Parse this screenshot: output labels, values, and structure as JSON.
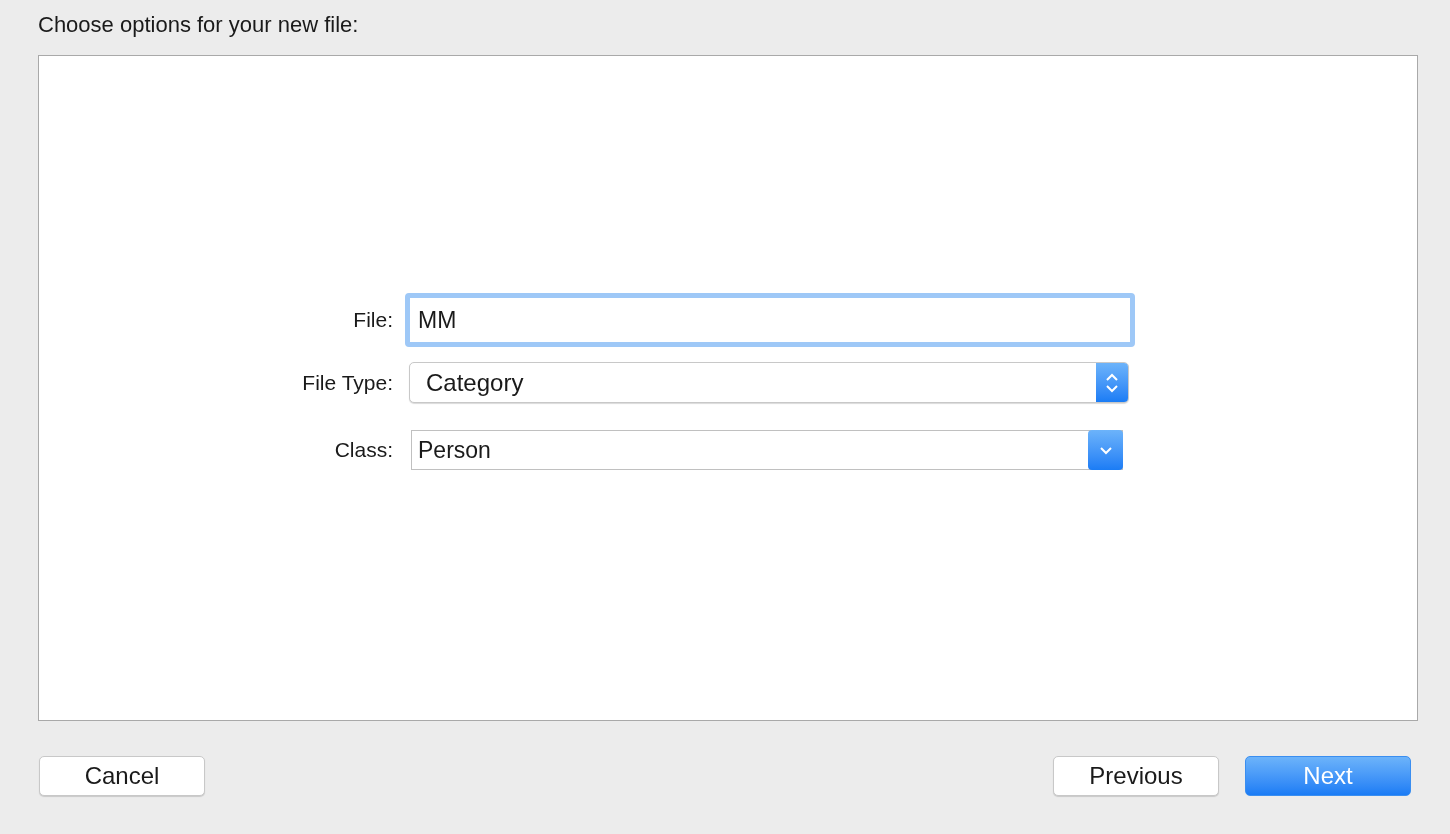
{
  "heading": "Choose options for your new file:",
  "fields": [
    {
      "label": "File:",
      "kind": "text",
      "value": "MM",
      "focused": true
    },
    {
      "label": "File Type:",
      "kind": "popup",
      "value": "Category"
    },
    {
      "label": "Class:",
      "kind": "combo",
      "value": "Person"
    }
  ],
  "buttons": [
    {
      "label": "Cancel",
      "kind": "plain"
    },
    {
      "label": "Previous",
      "kind": "plain"
    },
    {
      "label": "Next",
      "kind": "default"
    }
  ]
}
